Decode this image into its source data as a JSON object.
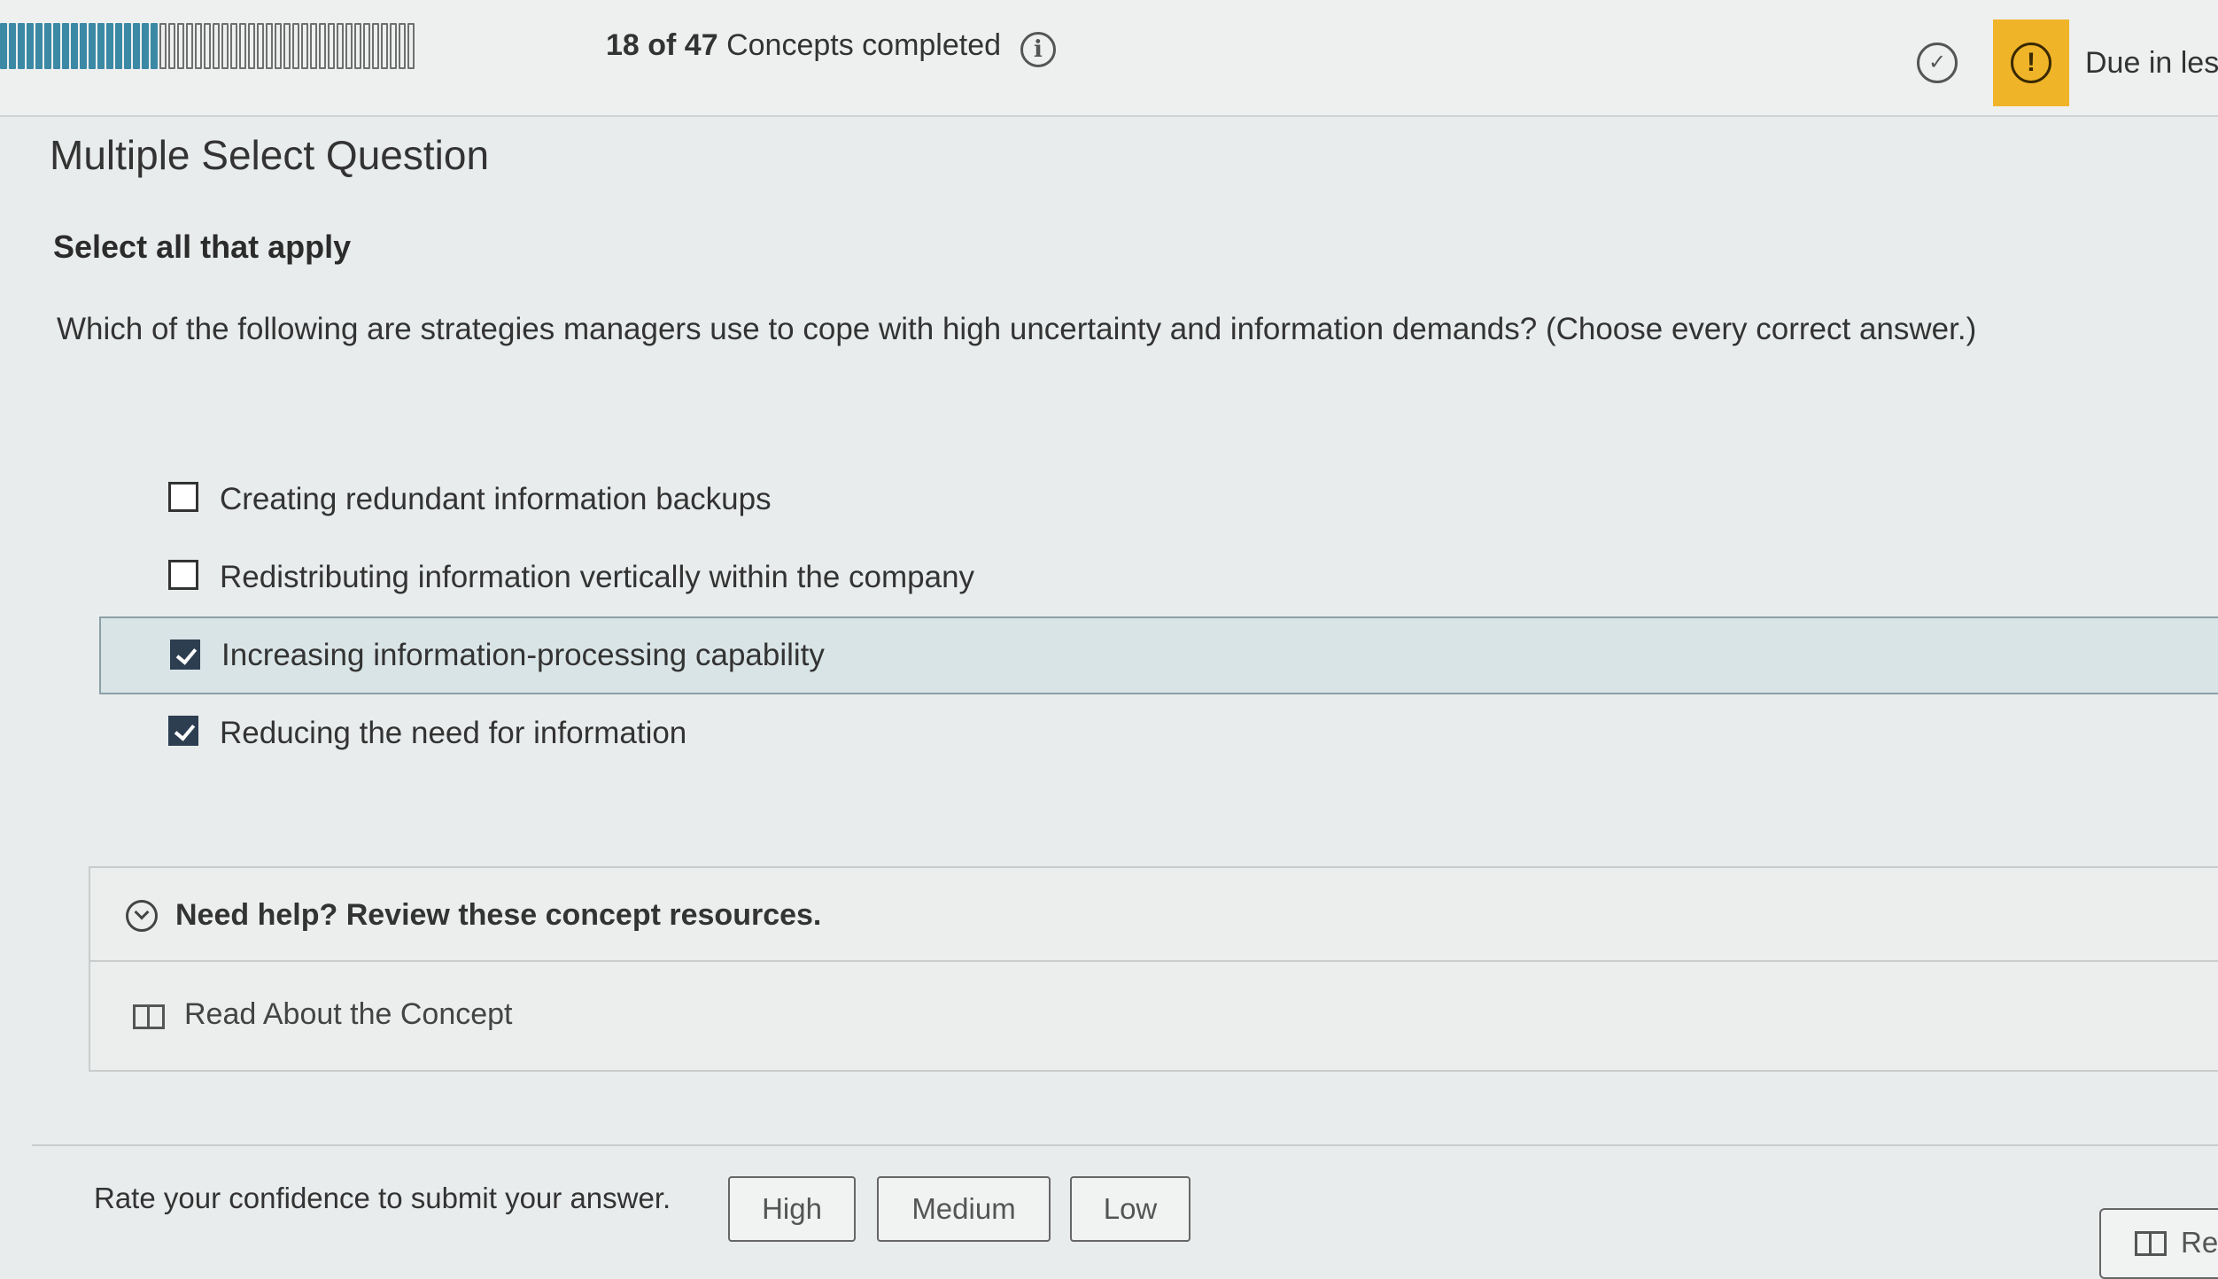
{
  "header": {
    "progress": {
      "completed": 18,
      "total": 47
    },
    "progress_count": "18 of 47",
    "progress_suffix": " Concepts completed",
    "due_text": "Due in les"
  },
  "question": {
    "type": "Multiple Select Question",
    "instruction": "Select all that apply",
    "prompt": "Which of the following are strategies managers use to cope with high uncertainty and information demands? (Choose every correct answer.)",
    "options": [
      {
        "label": "Creating redundant information backups",
        "checked": false,
        "focused": false
      },
      {
        "label": "Redistributing information vertically within the company",
        "checked": false,
        "focused": false
      },
      {
        "label": "Increasing information-processing capability",
        "checked": true,
        "focused": true
      },
      {
        "label": "Reducing the need for information",
        "checked": true,
        "focused": false
      }
    ]
  },
  "help": {
    "title": "Need help? Review these concept resources.",
    "link": "Read About the Concept"
  },
  "confidence": {
    "label": "Rate your confidence to submit your answer.",
    "high": "High",
    "medium": "Medium",
    "low": "Low"
  },
  "footer": {
    "read_button": "Re"
  },
  "icons": [
    "info-icon",
    "check-circle-icon",
    "alert-icon",
    "chevron-circle-icon",
    "book-icon"
  ],
  "colors": {
    "progress_done": "#3c89a6",
    "due_alert": "#f0b429",
    "selected_row": "#d9e4e6"
  }
}
